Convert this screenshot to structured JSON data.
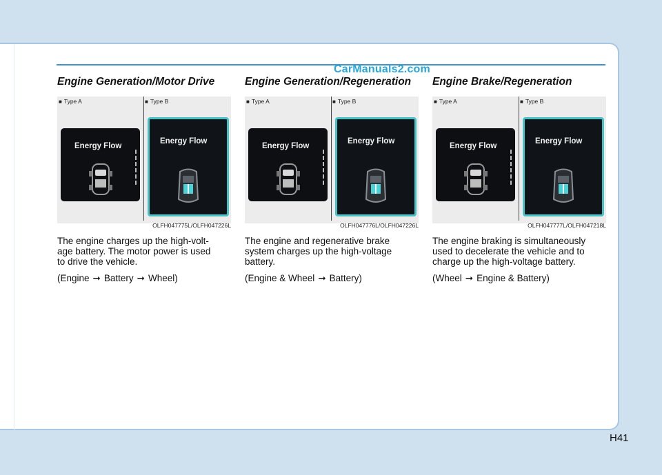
{
  "watermark": "CarManuals2.com",
  "page_number": "H41",
  "sections": [
    {
      "title": "Engine Generation/Motor Drive",
      "type_a": "Type A",
      "type_b": "Type B",
      "screen_label": "Energy Flow",
      "figure_code": "OLFH047775L/OLFH047226L",
      "paragraph": [
        "The engine charges up the high-volt-",
        "age battery. The motor power is used",
        "to drive the vehicle."
      ],
      "flow": [
        "(Engine",
        "Battery",
        "Wheel)"
      ]
    },
    {
      "title": "Engine Generation/Regeneration",
      "type_a": "Type A",
      "type_b": "Type B",
      "screen_label": "Energy Flow",
      "figure_code": "OLFH047776L/OLFH047226L",
      "paragraph": [
        "The engine and regenerative brake",
        "system charges up the high-voltage",
        "battery."
      ],
      "flow": [
        "(Engine & Wheel",
        "Battery)"
      ]
    },
    {
      "title": "Engine Brake/Regeneration",
      "type_a": "Type A",
      "type_b": "Type B",
      "screen_label": "Energy Flow",
      "figure_code": "OLFH047777L/OLFH047218L",
      "paragraph": [
        "The engine braking is simultaneously",
        "used to decelerate the vehicle and to",
        "charge up the high-voltage battery."
      ],
      "flow": [
        "(Wheel",
        "Engine & Battery)"
      ]
    }
  ],
  "colors": {
    "background": "#cfe0ee",
    "rule": "#3f93cf",
    "watermark": "#2aa7d8",
    "screen_b_border": "#47c3c8"
  },
  "icons": {
    "bullet": "square-bullet-icon",
    "arrow": "right-arrow-icon",
    "car": "car-top-view-icon"
  }
}
